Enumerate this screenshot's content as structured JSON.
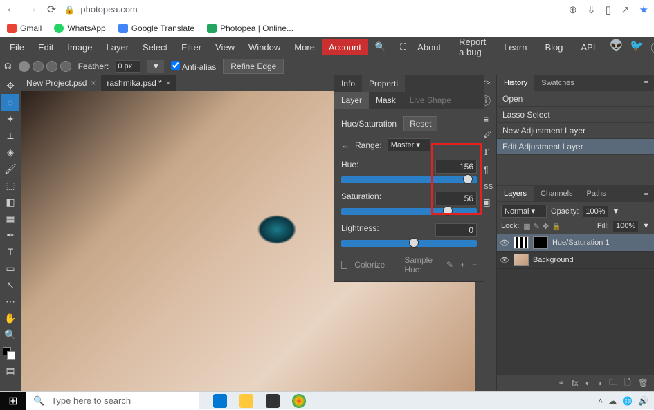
{
  "browser": {
    "url": "photopea.com",
    "bookmarks": [
      {
        "label": "Gmail",
        "cls": "bm-gmail"
      },
      {
        "label": "WhatsApp",
        "cls": "bm-whatsapp"
      },
      {
        "label": "Google Translate",
        "cls": "bm-translate"
      },
      {
        "label": "Photopea | Online...",
        "cls": "bm-photopea"
      }
    ]
  },
  "menu": {
    "items": [
      "File",
      "Edit",
      "Image",
      "Layer",
      "Select",
      "Filter",
      "View",
      "Window",
      "More"
    ],
    "account": "Account",
    "right": [
      "About",
      "Report a bug",
      "Learn",
      "Blog",
      "API"
    ]
  },
  "options": {
    "feather_label": "Feather:",
    "feather_value": "0 px",
    "antialias": "Anti-alias",
    "refine": "Refine Edge"
  },
  "tabs": [
    {
      "label": "New Project.psd",
      "active": false
    },
    {
      "label": "rashmika.psd *",
      "active": true
    }
  ],
  "props": {
    "tabs": {
      "info": "Info",
      "properties": "Properti"
    },
    "subtabs": {
      "layer": "Layer",
      "mask": "Mask",
      "live": "Live Shape"
    },
    "title": "Hue/Saturation",
    "reset": "Reset",
    "range_label": "Range:",
    "range_value": "Master",
    "hue_label": "Hue:",
    "hue_value": "156",
    "sat_label": "Saturation:",
    "sat_value": "56",
    "light_label": "Lightness:",
    "light_value": "0",
    "colorize": "Colorize",
    "sample": "Sample Hue:"
  },
  "history": {
    "tabs": {
      "history": "History",
      "swatches": "Swatches"
    },
    "items": [
      "Open",
      "Lasso Select",
      "New Adjustment Layer",
      "Edit Adjustment Layer"
    ]
  },
  "layers_panel": {
    "tabs": {
      "layers": "Layers",
      "channels": "Channels",
      "paths": "Paths"
    },
    "blend": "Normal",
    "opacity_label": "Opacity:",
    "opacity_value": "100%",
    "lock_label": "Lock:",
    "fill_label": "Fill:",
    "fill_value": "100%",
    "layers": [
      {
        "name": "Hue/Saturation 1",
        "selected": true
      },
      {
        "name": "Background",
        "selected": false
      }
    ]
  },
  "mini_top": "<>",
  "css_label": "CSS",
  "taskbar": {
    "search_placeholder": "Type here to search"
  }
}
